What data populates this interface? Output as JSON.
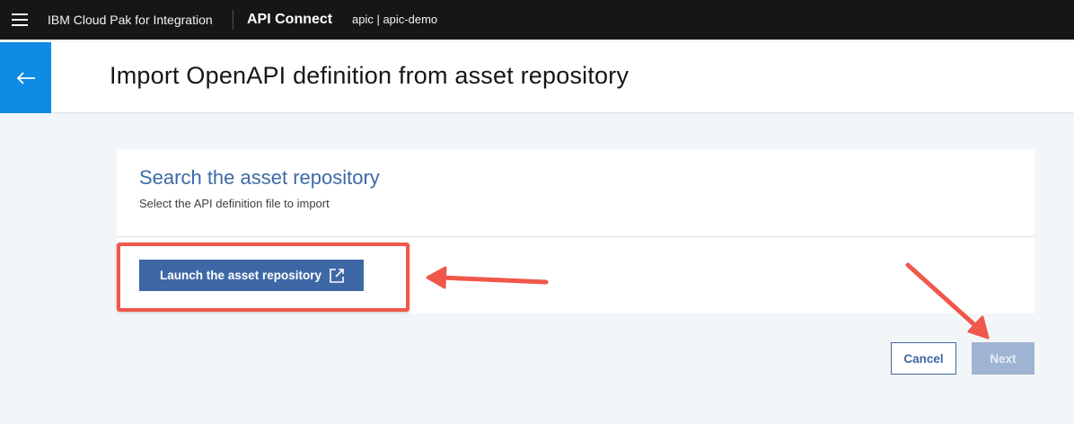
{
  "topbar": {
    "brand": "IBM Cloud Pak for Integration",
    "product": "API Connect",
    "context": "apic | apic-demo"
  },
  "header": {
    "title": "Import OpenAPI definition from asset repository"
  },
  "card": {
    "title": "Search the asset repository",
    "subtitle": "Select the API definition file to import",
    "launch_label": "Launch the asset repository"
  },
  "actions": {
    "cancel_label": "Cancel",
    "next_label": "Next",
    "next_enabled": false
  },
  "icons": {
    "menu": "hamburger-menu-icon",
    "back": "arrow-left-icon",
    "launch": "external-link-icon"
  },
  "colors": {
    "topbar": "#161616",
    "back_button": "#0f8be6",
    "primary": "#3e68a5",
    "primary_disabled": "#9fb4d3",
    "annotation": "#f1574a"
  }
}
